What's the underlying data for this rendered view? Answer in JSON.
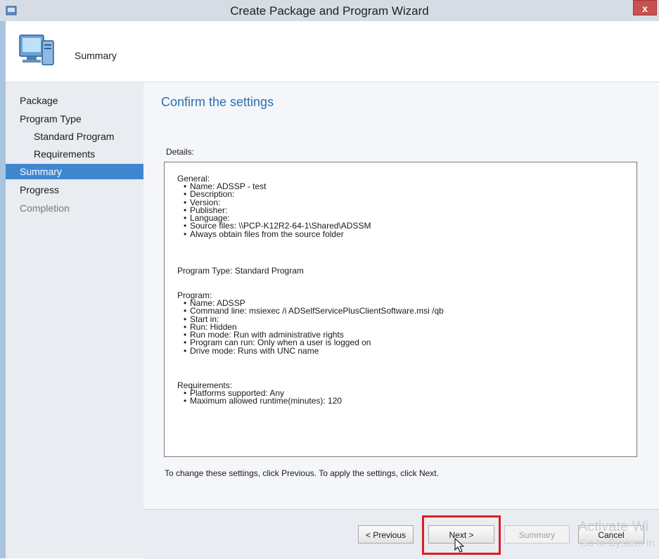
{
  "window": {
    "title": "Create Package and Program Wizard",
    "close_label": "x"
  },
  "header": {
    "title": "Summary",
    "icon": "computer-icon"
  },
  "nav": {
    "items": [
      {
        "label": "Package",
        "state": "normal"
      },
      {
        "label": "Program Type",
        "state": "normal"
      },
      {
        "label": "Standard Program",
        "state": "normal"
      },
      {
        "label": "Requirements",
        "state": "normal"
      },
      {
        "label": "Summary",
        "state": "selected"
      },
      {
        "label": "Progress",
        "state": "normal"
      },
      {
        "label": "Completion",
        "state": "disabled"
      }
    ]
  },
  "content": {
    "heading": "Confirm the settings",
    "details_label": "Details:",
    "general": {
      "title": "General:",
      "items": [
        "Name: ADSSP - test",
        "Description:",
        "Version:",
        "Publisher:",
        "Language:",
        "Source files: \\\\PCP-K12R2-64-1\\Shared\\ADSSM",
        "Always obtain files from the source folder"
      ]
    },
    "program_type": "Program Type: Standard Program",
    "program": {
      "title": "Program:",
      "items": [
        "Name: ADSSP",
        "Command line: msiexec /i ADSelfServicePlusClientSoftware.msi /qb",
        "Start in:",
        "Run: Hidden",
        "Run mode: Run with administrative rights",
        "Program can run: Only when a user is logged on",
        "Drive mode: Runs with UNC name"
      ]
    },
    "requirements": {
      "title": "Requirements:",
      "items": [
        "Platforms supported: Any",
        "Maximum allowed runtime(minutes): 120"
      ]
    },
    "footnote": "To change these settings, click Previous. To apply the settings, click Next."
  },
  "buttons": {
    "previous": "< Previous",
    "next": "Next >",
    "summary": "Summary",
    "cancel": "Cancel"
  },
  "watermark": {
    "line1": "Activate Wi",
    "line2": "Go to System in"
  },
  "colors": {
    "accent": "#3f86cf",
    "heading": "#2a6fb0",
    "highlight": "#d71f26"
  }
}
